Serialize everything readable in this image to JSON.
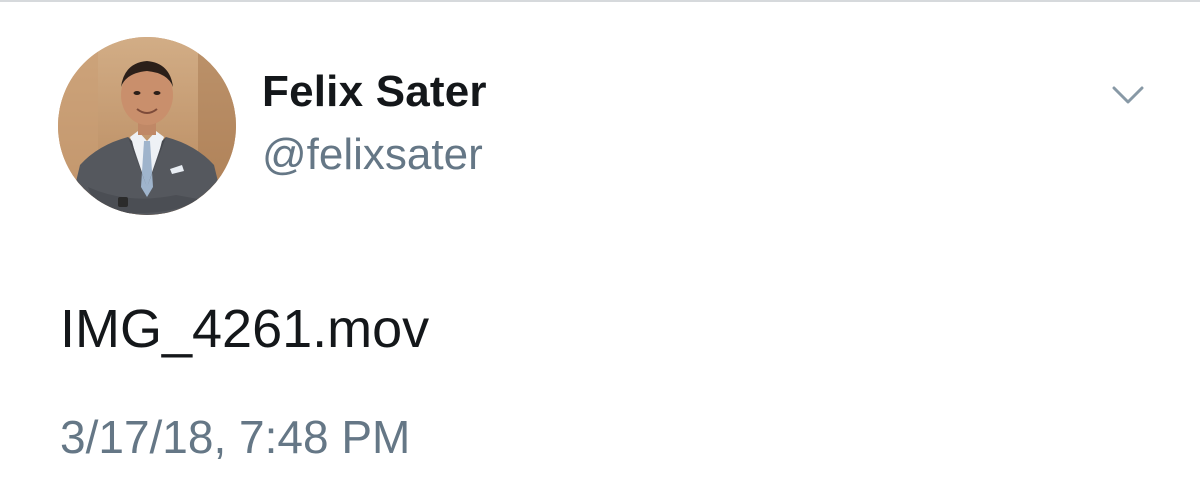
{
  "tweet": {
    "author": {
      "display_name": "Felix Sater",
      "handle": "@felixsater",
      "avatar_icon": "profile-photo"
    },
    "menu_icon": "chevron-down-icon",
    "text": "IMG_4261.mov",
    "timestamp": "3/17/18, 7:48 PM"
  },
  "colors": {
    "primary_text": "#14171a",
    "secondary_text": "#657786",
    "divider": "#d6d9dc",
    "caret": "#8899a6",
    "background": "#ffffff"
  }
}
